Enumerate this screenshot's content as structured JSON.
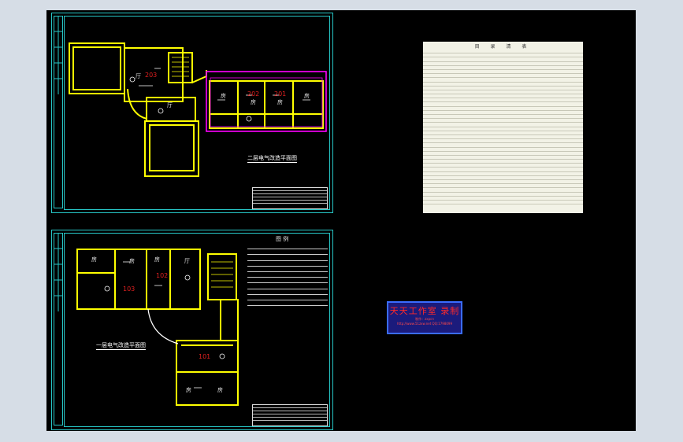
{
  "drawing": {
    "top_sheet": {
      "title": "二层电气改造平面图",
      "rooms": [
        "203",
        "202",
        "201"
      ],
      "room_labels": [
        "厅",
        "厅",
        "房",
        "房",
        "房",
        "房"
      ]
    },
    "bottom_sheet": {
      "title": "一层电气改造平面图",
      "rooms": [
        "103",
        "102",
        "101"
      ],
      "room_labels": [
        "房",
        "房",
        "房",
        "厅",
        "房",
        "房"
      ],
      "legend_title": "图 例"
    },
    "pdf_sheet": {
      "title": "目 录 清 表"
    },
    "watermark": {
      "title": "天天工作室 录制",
      "line1": "制作：zxpcn",
      "line2": "http://www.51zxw.net   QQ:1798099"
    }
  },
  "colors": {
    "canvas": "#000000",
    "frame": "#27c7c7",
    "walls": "#ffff00",
    "rooms": "#e02020",
    "magenta": "#ff00ff",
    "background": "#d6dde6"
  }
}
